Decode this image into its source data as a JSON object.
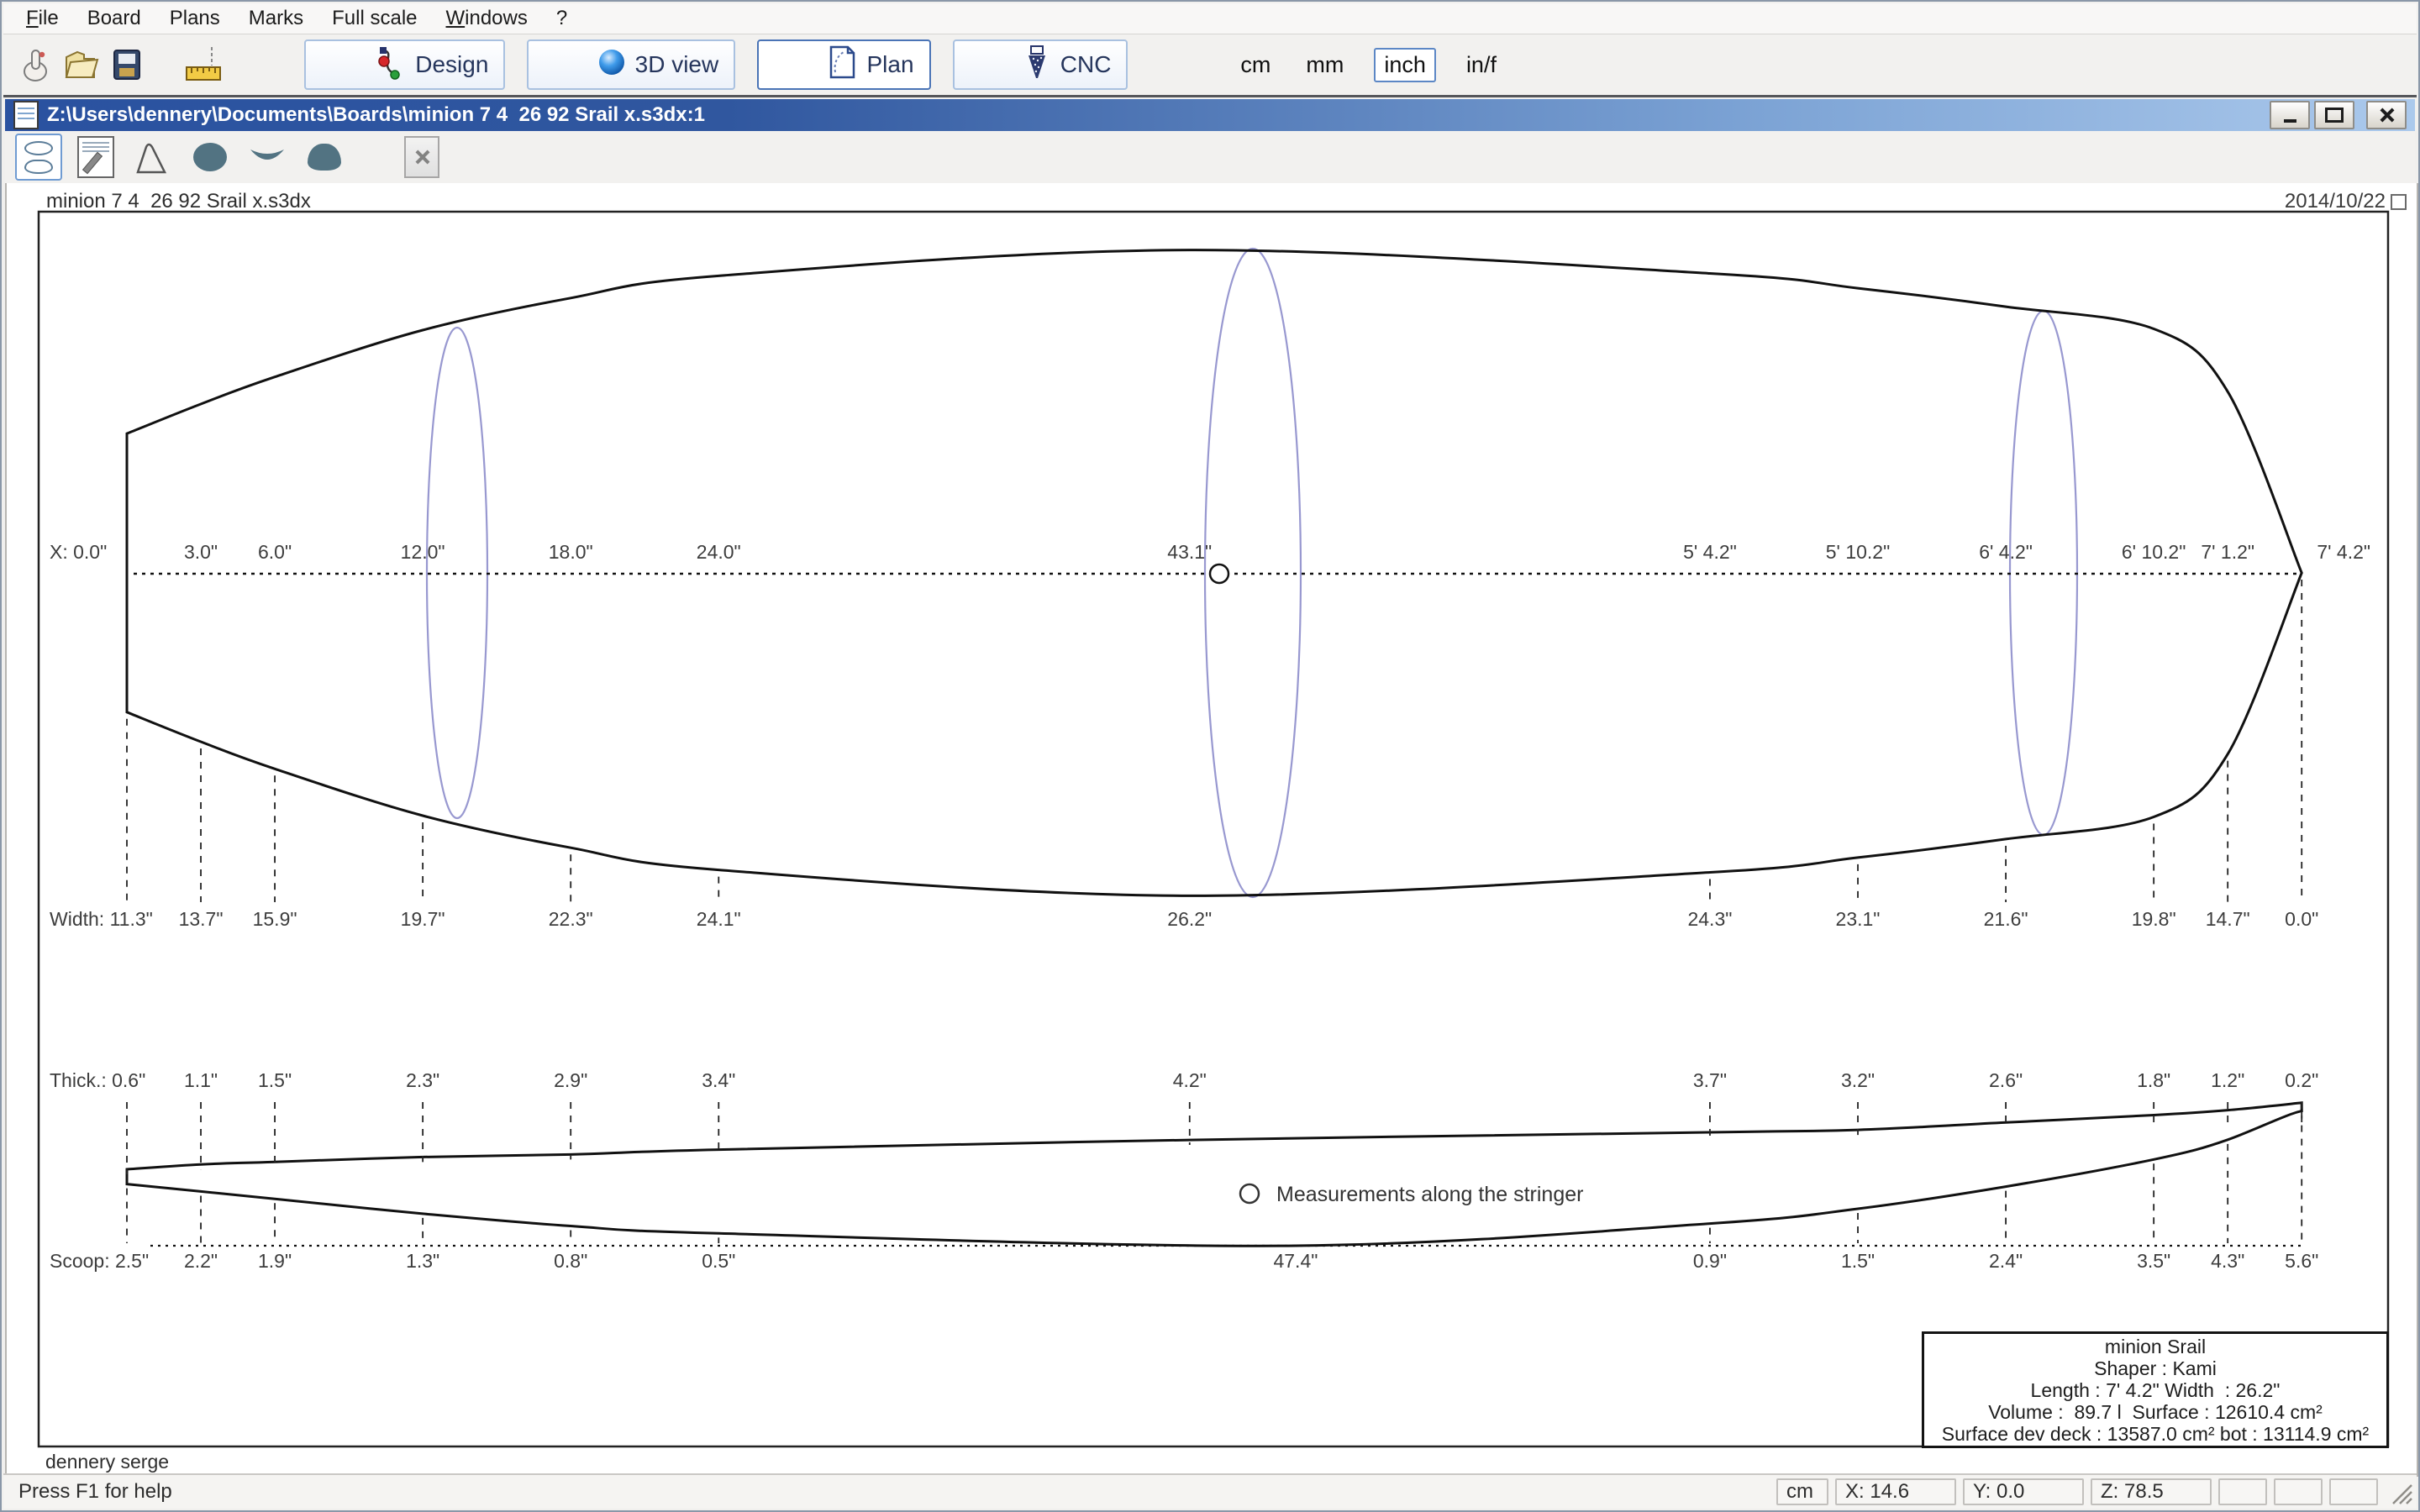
{
  "menu": {
    "items": [
      {
        "label": "File",
        "underline_first": true
      },
      {
        "label": "Board",
        "underline_first": false
      },
      {
        "label": "Plans",
        "underline_first": false
      },
      {
        "label": "Marks",
        "underline_first": false
      },
      {
        "label": "Full scale",
        "underline_first": false
      },
      {
        "label": "Windows",
        "underline_first": true
      },
      {
        "label": "?",
        "underline_first": false
      }
    ]
  },
  "toolbar": {
    "design_label": "Design",
    "view3d_label": "3D view",
    "plan_label": "Plan",
    "cnc_label": "CNC",
    "units": [
      {
        "label": "cm",
        "active": false
      },
      {
        "label": "mm",
        "active": false
      },
      {
        "label": "inch",
        "active": true
      },
      {
        "label": "in/f",
        "active": false
      }
    ]
  },
  "icons": {
    "toolbar": [
      "pointer-hand",
      "open-folder",
      "save-book",
      "measure-ruler",
      "design-nodes",
      "sphere-3d",
      "plan-page",
      "cnc-bit"
    ],
    "view_toolbar": [
      "outline-view",
      "spec-sheet",
      "profile-curve",
      "slice-disc",
      "slice-bottom",
      "slice-rail",
      "export-grayed"
    ]
  },
  "window": {
    "title": "Z:\\Users\\dennery\\Documents\\Boards\\minion 7 4  26 92 Srail x.s3dx:1"
  },
  "canvas": {
    "file_label": "minion 7 4  26 92 Srail x.s3dx",
    "date": "2014/10/22",
    "author": "dennery serge",
    "legend": "Measurements along the stringer",
    "measurements": {
      "x_prefix": "X: ",
      "width_prefix": "Width: ",
      "thick_prefix": "Thick.: ",
      "scoop_prefix": "Scoop: ",
      "stations_in": [
        0,
        3,
        6,
        12,
        18,
        24,
        43.1,
        64.2,
        70.2,
        76.2,
        82.2,
        85.2,
        88.2
      ],
      "x_labels": [
        "0.0\"",
        "3.0\"",
        "6.0\"",
        "12.0\"",
        "18.0\"",
        "24.0\"",
        "43.1\"",
        "5' 4.2\"",
        "5' 10.2\"",
        "6' 4.2\"",
        "6' 10.2\"",
        "7' 1.2\"",
        "7' 4.2\""
      ],
      "width_in": [
        11.3,
        13.7,
        15.9,
        19.7,
        22.3,
        24.1,
        26.2,
        24.3,
        23.1,
        21.6,
        19.8,
        14.7,
        0.0
      ],
      "width_labels": [
        "11.3\"",
        "13.7\"",
        "15.9\"",
        "19.7\"",
        "22.3\"",
        "24.1\"",
        "26.2\"",
        "24.3\"",
        "23.1\"",
        "21.6\"",
        "19.8\"",
        "14.7\"",
        "0.0\""
      ],
      "thick_in": [
        0.6,
        1.1,
        1.5,
        2.3,
        2.9,
        3.4,
        4.2,
        3.7,
        3.2,
        2.6,
        1.8,
        1.2,
        0.2
      ],
      "thick_labels": [
        "0.6\"",
        "1.1\"",
        "1.5\"",
        "2.3\"",
        "2.9\"",
        "3.4\"",
        "4.2\"",
        "3.7\"",
        "3.2\"",
        "2.6\"",
        "1.8\"",
        "1.2\"",
        "0.2\""
      ],
      "scoop_stations_in": [
        0,
        3,
        6,
        12,
        18,
        24,
        47.4,
        64.2,
        70.2,
        76.2,
        82.2,
        85.2,
        88.2
      ],
      "scoop_in": [
        2.5,
        2.2,
        1.9,
        1.3,
        0.8,
        0.5,
        0.0,
        0.9,
        1.5,
        2.4,
        3.5,
        4.3,
        5.6
      ],
      "scoop_labels": [
        "2.5\"",
        "2.2\"",
        "1.9\"",
        "1.3\"",
        "0.8\"",
        "0.5\"",
        "47.4\"",
        "0.9\"",
        "1.5\"",
        "2.4\"",
        "3.5\"",
        "4.3\"",
        "5.6\""
      ]
    },
    "slice_color": "#9898d0",
    "outline_color": "#111111"
  },
  "info_box": {
    "lines": [
      "minion Srail",
      "Shaper : Kami",
      "Length : 7' 4.2\" Width  : 26.2\"",
      "Volume :  89.7 l  Surface : 12610.4 cm²",
      "Surface dev deck : 13587.0 cm² bot : 13114.9 cm²"
    ]
  },
  "status_bar": {
    "help": "Press F1 for help",
    "unit": "cm",
    "x": "X: 14.6",
    "y": "Y: 0.0",
    "z": "Z: 78.5"
  }
}
